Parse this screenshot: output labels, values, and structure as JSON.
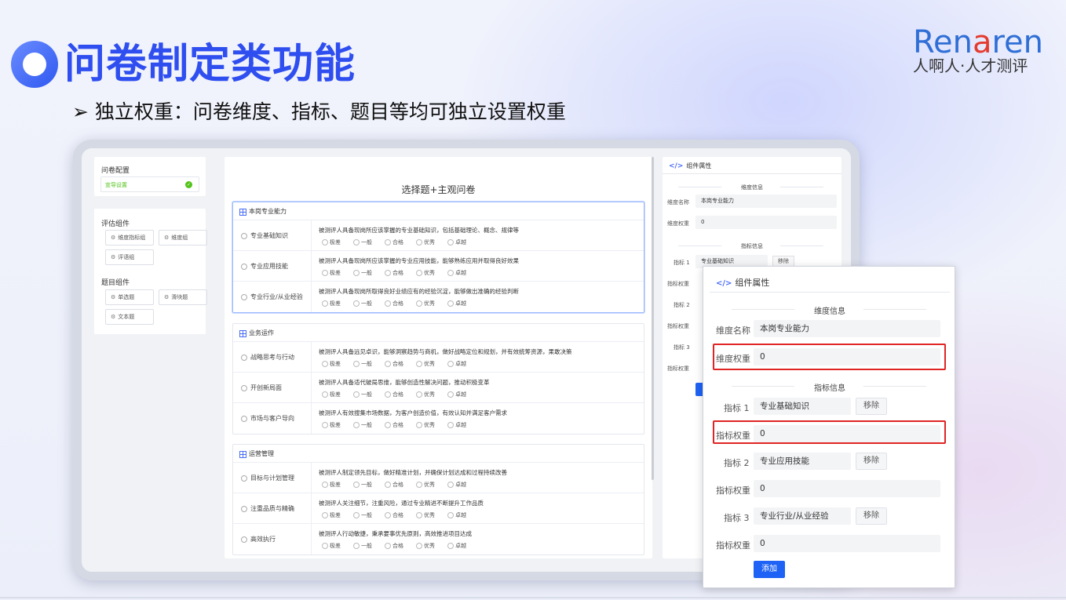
{
  "slide": {
    "title": "问卷制定类功能",
    "subtitle": "➢  独立权重：问卷维度、指标、题目等均可独立设置权重",
    "brand_main_1": "Ren",
    "brand_main_a": "a",
    "brand_main_2": "ren",
    "brand_sub": "人啊人·人才测评",
    "accent_color": "#2f4ef0"
  },
  "left_panel": {
    "config_title": "问卷配置",
    "config_item": "宣导设置",
    "eval_title": "评估组件",
    "eval_items": [
      "维度指标组",
      "维度组",
      "评语组"
    ],
    "question_title": "题目组件",
    "question_items": [
      "单选题",
      "滑块题",
      "文本题"
    ]
  },
  "center": {
    "title": "选择题+主观问卷",
    "options": [
      "极差",
      "一般",
      "合格",
      "优秀",
      "卓越"
    ],
    "sections": [
      {
        "name": "本岗专业能力",
        "rows": [
          {
            "name": "专业基础知识",
            "desc": "被测评人具备现岗所应该掌握的专业基础知识，包括基础理论、概念、规律等"
          },
          {
            "name": "专业应用技能",
            "desc": "被测评人具备现岗所应该掌握的专业应用技能，能够熟练应用并取得良好效果"
          },
          {
            "name": "专业行业/从业经验",
            "desc": "被测评人具备现岗所取得良好业绩应有的经验沉淀，能够做出准确的经验判断"
          }
        ]
      },
      {
        "name": "业务运作",
        "rows": [
          {
            "name": "战略思考与行动",
            "desc": "被测评人具备远见卓识，能够洞察趋势与商机，做好战略定位和规划，并有效统筹资源，果敢决策"
          },
          {
            "name": "开创新局面",
            "desc": "被测评人具备适代破局思维，能够创造性解决问题，推动积极变革"
          },
          {
            "name": "市场与客户导向",
            "desc": "被测评人有效搜集市场数据，为客户创造价值，有效认知并满足客户需求"
          }
        ]
      },
      {
        "name": "运营管理",
        "rows": [
          {
            "name": "目标与计划管理",
            "desc": "被测评人制定领先目标，做好精准计划，并确保计划达成和过程持续改善"
          },
          {
            "name": "注重品质与精确",
            "desc": "被测评人关注细节，注重风险，通过专业精进不断提升工作品质"
          },
          {
            "name": "高效执行",
            "desc": "被测评人行动敏捷，秉承要事优先原则，高效推进项目达成"
          }
        ]
      }
    ]
  },
  "right_panel": {
    "header": "组件属性",
    "dim_info": "维度信息",
    "dim_name_label": "维度名称",
    "dim_name_value": "本岗专业能力",
    "dim_weight_label": "维度权重",
    "dim_weight_value": "0",
    "indicator_info": "指标信息",
    "indicator_1_label": "指标 1",
    "indicator_1_value": "专业基础知识",
    "indicator_2_label": "指标 2",
    "indicator_3_label": "指标 3",
    "weight_label": "指标权重",
    "remove_label": "移除"
  },
  "zoom_panel": {
    "header": "组件属性",
    "dim_info": "维度信息",
    "dim_name_label": "维度名称",
    "dim_name_value": "本岗专业能力",
    "dim_weight_label": "维度权重",
    "dim_weight_value": "0",
    "indicator_info": "指标信息",
    "indicators": [
      {
        "label": "指标 1",
        "value": "专业基础知识",
        "weight_label": "指标权重",
        "weight": "0"
      },
      {
        "label": "指标 2",
        "value": "专业应用技能",
        "weight_label": "指标权重",
        "weight": "0"
      },
      {
        "label": "指标 3",
        "value": "专业行业/从业经验",
        "weight_label": "指标权重",
        "weight": "0"
      }
    ],
    "remove_label": "移除",
    "add_label": "添加",
    "add_color": "#1e63f5",
    "highlight_color": "#e02424"
  }
}
